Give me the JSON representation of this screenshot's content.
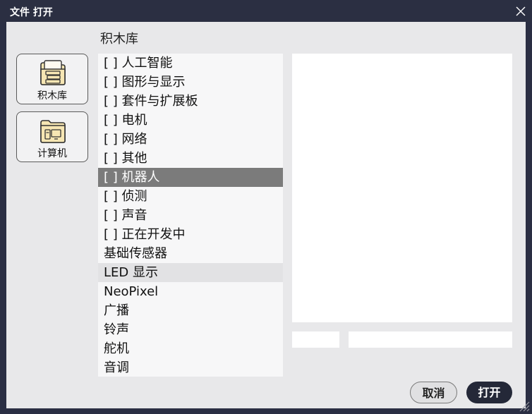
{
  "window": {
    "title": "文件 打开"
  },
  "path": {
    "label": "积木库"
  },
  "places": [
    {
      "label": "积木库",
      "icon": "library-icon"
    },
    {
      "label": "计算机",
      "icon": "computer-icon"
    }
  ],
  "list": {
    "items": [
      "[ ] 人工智能",
      "[ ] 图形与显示",
      "[ ] 套件与扩展板",
      "[ ] 电机",
      "[ ] 网络",
      "[ ] 其他",
      "[ ] 机器人",
      "[ ] 侦测",
      "[ ] 声音",
      "[ ] 正在开发中",
      "基础传感器",
      "LED 显示",
      "NeoPixel",
      "广播",
      "铃声",
      "舵机",
      "音调"
    ],
    "selected": "[ ] 机器人",
    "hovered": "LED 显示"
  },
  "buttons": {
    "cancel": "取消",
    "open": "打开"
  },
  "colors": {
    "titlebar": "#2b2f42",
    "selection": "#7b7b7b",
    "open_button": "#242838",
    "icon_fill": "#f6e6b3"
  }
}
